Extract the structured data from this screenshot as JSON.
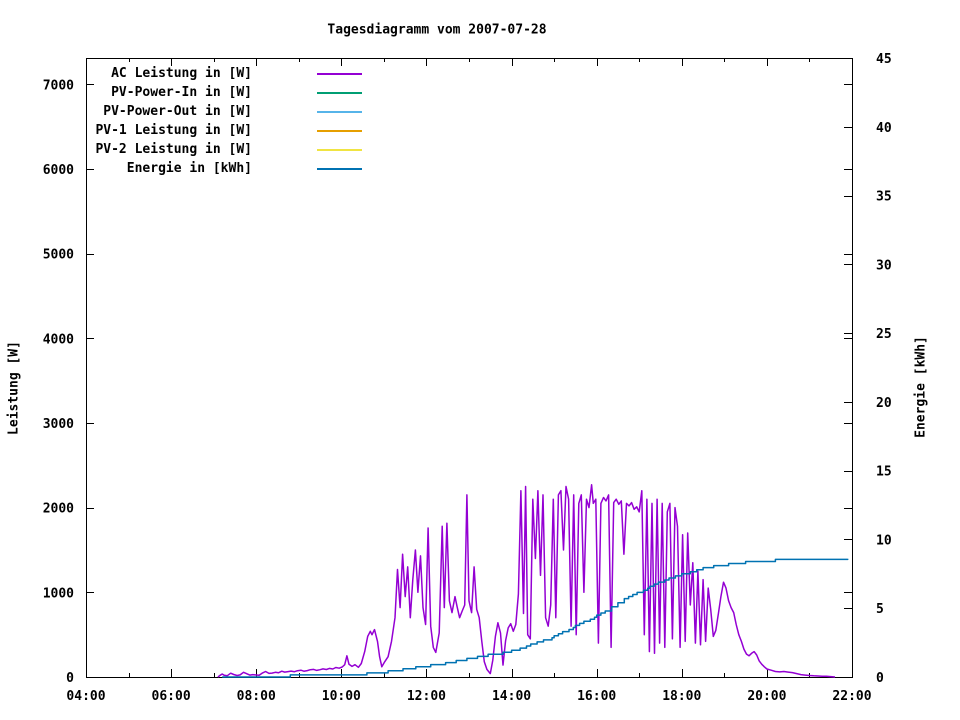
{
  "title": "Tagesdiagramm vom 2007-07-28",
  "axes": {
    "y_label": "Leistung [W]",
    "y2_label": "Energie [kWh]",
    "x_ticks": [
      {
        "h": 4,
        "label": "04:00"
      },
      {
        "h": 6,
        "label": "06:00"
      },
      {
        "h": 8,
        "label": "08:00"
      },
      {
        "h": 10,
        "label": "10:00"
      },
      {
        "h": 12,
        "label": "12:00"
      },
      {
        "h": 14,
        "label": "14:00"
      },
      {
        "h": 16,
        "label": "16:00"
      },
      {
        "h": 18,
        "label": "18:00"
      },
      {
        "h": 20,
        "label": "20:00"
      },
      {
        "h": 22,
        "label": "22:00"
      }
    ],
    "x_minor_hours": [
      5,
      7,
      9,
      11,
      13,
      15,
      17,
      19,
      21
    ],
    "y_ticks": [
      0,
      1000,
      2000,
      3000,
      4000,
      5000,
      6000,
      7000
    ],
    "y2_ticks": [
      0,
      5,
      10,
      15,
      20,
      25,
      30,
      35,
      40,
      45
    ]
  },
  "chart_data": {
    "type": "line",
    "title": "Tagesdiagramm vom 2007-07-28",
    "xlabel": "",
    "ylabel": "Leistung [W]",
    "y2label": "Energie [kWh]",
    "xlim": [
      4,
      22
    ],
    "ylim": [
      0,
      7310
    ],
    "y2lim": [
      0,
      45
    ],
    "grid": false,
    "legend_position": "top-left-inside",
    "series": [
      {
        "name": "AC Leistung in [W]",
        "color": "#9400D3",
        "axis": "y",
        "style": "line",
        "points": [
          [
            7.1,
            0
          ],
          [
            7.15,
            20
          ],
          [
            7.2,
            35
          ],
          [
            7.25,
            20
          ],
          [
            7.32,
            15
          ],
          [
            7.4,
            45
          ],
          [
            7.47,
            30
          ],
          [
            7.55,
            18
          ],
          [
            7.62,
            25
          ],
          [
            7.7,
            55
          ],
          [
            7.77,
            40
          ],
          [
            7.85,
            22
          ],
          [
            7.92,
            28
          ],
          [
            8.0,
            24
          ],
          [
            8.07,
            20
          ],
          [
            8.15,
            48
          ],
          [
            8.22,
            65
          ],
          [
            8.3,
            42
          ],
          [
            8.37,
            46
          ],
          [
            8.45,
            55
          ],
          [
            8.52,
            50
          ],
          [
            8.6,
            68
          ],
          [
            8.67,
            58
          ],
          [
            8.75,
            64
          ],
          [
            8.82,
            70
          ],
          [
            8.9,
            62
          ],
          [
            8.97,
            74
          ],
          [
            9.05,
            80
          ],
          [
            9.12,
            68
          ],
          [
            9.2,
            76
          ],
          [
            9.27,
            86
          ],
          [
            9.35,
            90
          ],
          [
            9.42,
            78
          ],
          [
            9.5,
            86
          ],
          [
            9.57,
            96
          ],
          [
            9.65,
            88
          ],
          [
            9.72,
            102
          ],
          [
            9.8,
            94
          ],
          [
            9.87,
            112
          ],
          [
            9.95,
            104
          ],
          [
            10.02,
            118
          ],
          [
            10.08,
            145
          ],
          [
            10.13,
            250
          ],
          [
            10.18,
            150
          ],
          [
            10.25,
            125
          ],
          [
            10.32,
            145
          ],
          [
            10.4,
            115
          ],
          [
            10.47,
            160
          ],
          [
            10.55,
            300
          ],
          [
            10.62,
            480
          ],
          [
            10.68,
            540
          ],
          [
            10.72,
            500
          ],
          [
            10.78,
            560
          ],
          [
            10.85,
            420
          ],
          [
            10.9,
            240
          ],
          [
            10.95,
            120
          ],
          [
            11.02,
            180
          ],
          [
            11.1,
            240
          ],
          [
            11.18,
            420
          ],
          [
            11.26,
            700
          ],
          [
            11.32,
            1270
          ],
          [
            11.38,
            820
          ],
          [
            11.44,
            1450
          ],
          [
            11.5,
            950
          ],
          [
            11.56,
            1300
          ],
          [
            11.62,
            700
          ],
          [
            11.68,
            1150
          ],
          [
            11.74,
            1500
          ],
          [
            11.8,
            1000
          ],
          [
            11.86,
            1430
          ],
          [
            11.92,
            820
          ],
          [
            11.98,
            620
          ],
          [
            12.04,
            1760
          ],
          [
            12.1,
            600
          ],
          [
            12.16,
            350
          ],
          [
            12.22,
            290
          ],
          [
            12.3,
            520
          ],
          [
            12.37,
            1780
          ],
          [
            12.42,
            820
          ],
          [
            12.48,
            1815
          ],
          [
            12.54,
            900
          ],
          [
            12.6,
            760
          ],
          [
            12.67,
            950
          ],
          [
            12.72,
            830
          ],
          [
            12.78,
            700
          ],
          [
            12.84,
            780
          ],
          [
            12.9,
            850
          ],
          [
            12.95,
            2150
          ],
          [
            13.0,
            900
          ],
          [
            13.06,
            760
          ],
          [
            13.12,
            1300
          ],
          [
            13.18,
            800
          ],
          [
            13.24,
            700
          ],
          [
            13.3,
            420
          ],
          [
            13.36,
            180
          ],
          [
            13.42,
            90
          ],
          [
            13.5,
            40
          ],
          [
            13.56,
            200
          ],
          [
            13.62,
            480
          ],
          [
            13.68,
            640
          ],
          [
            13.74,
            520
          ],
          [
            13.8,
            140
          ],
          [
            13.86,
            430
          ],
          [
            13.92,
            580
          ],
          [
            13.98,
            630
          ],
          [
            14.04,
            540
          ],
          [
            14.1,
            620
          ],
          [
            14.16,
            980
          ],
          [
            14.22,
            2200
          ],
          [
            14.28,
            750
          ],
          [
            14.33,
            2250
          ],
          [
            14.38,
            500
          ],
          [
            14.44,
            450
          ],
          [
            14.5,
            2100
          ],
          [
            14.56,
            1400
          ],
          [
            14.62,
            2200
          ],
          [
            14.68,
            1200
          ],
          [
            14.74,
            2150
          ],
          [
            14.8,
            700
          ],
          [
            14.86,
            600
          ],
          [
            14.92,
            850
          ],
          [
            14.98,
            2100
          ],
          [
            15.04,
            700
          ],
          [
            15.1,
            2150
          ],
          [
            15.16,
            2200
          ],
          [
            15.22,
            1500
          ],
          [
            15.28,
            2250
          ],
          [
            15.34,
            2100
          ],
          [
            15.4,
            600
          ],
          [
            15.46,
            2150
          ],
          [
            15.52,
            500
          ],
          [
            15.58,
            2050
          ],
          [
            15.64,
            2150
          ],
          [
            15.7,
            1000
          ],
          [
            15.76,
            2100
          ],
          [
            15.82,
            2000
          ],
          [
            15.88,
            2270
          ],
          [
            15.92,
            2050
          ],
          [
            15.98,
            2100
          ],
          [
            16.04,
            400
          ],
          [
            16.1,
            2050
          ],
          [
            16.16,
            2120
          ],
          [
            16.22,
            2080
          ],
          [
            16.28,
            2150
          ],
          [
            16.34,
            350
          ],
          [
            16.4,
            2060
          ],
          [
            16.46,
            2100
          ],
          [
            16.52,
            2040
          ],
          [
            16.58,
            2080
          ],
          [
            16.64,
            1450
          ],
          [
            16.7,
            2050
          ],
          [
            16.76,
            2020
          ],
          [
            16.82,
            2060
          ],
          [
            16.88,
            1980
          ],
          [
            16.94,
            2010
          ],
          [
            17.0,
            1950
          ],
          [
            17.06,
            2200
          ],
          [
            17.12,
            500
          ],
          [
            17.18,
            2100
          ],
          [
            17.24,
            300
          ],
          [
            17.3,
            2050
          ],
          [
            17.36,
            280
          ],
          [
            17.42,
            2100
          ],
          [
            17.48,
            400
          ],
          [
            17.54,
            2050
          ],
          [
            17.6,
            350
          ],
          [
            17.66,
            1950
          ],
          [
            17.72,
            2050
          ],
          [
            17.78,
            450
          ],
          [
            17.84,
            2000
          ],
          [
            17.9,
            1780
          ],
          [
            17.96,
            350
          ],
          [
            18.02,
            1680
          ],
          [
            18.08,
            420
          ],
          [
            18.14,
            1700
          ],
          [
            18.2,
            850
          ],
          [
            18.26,
            1350
          ],
          [
            18.32,
            400
          ],
          [
            18.38,
            1250
          ],
          [
            18.44,
            380
          ],
          [
            18.5,
            1150
          ],
          [
            18.56,
            420
          ],
          [
            18.62,
            1050
          ],
          [
            18.68,
            800
          ],
          [
            18.74,
            480
          ],
          [
            18.8,
            550
          ],
          [
            18.86,
            750
          ],
          [
            18.92,
            950
          ],
          [
            18.98,
            1120
          ],
          [
            19.04,
            1050
          ],
          [
            19.1,
            900
          ],
          [
            19.16,
            820
          ],
          [
            19.22,
            760
          ],
          [
            19.28,
            620
          ],
          [
            19.34,
            500
          ],
          [
            19.4,
            420
          ],
          [
            19.46,
            330
          ],
          [
            19.52,
            270
          ],
          [
            19.58,
            250
          ],
          [
            19.64,
            280
          ],
          [
            19.7,
            300
          ],
          [
            19.76,
            260
          ],
          [
            19.82,
            190
          ],
          [
            19.88,
            150
          ],
          [
            19.94,
            120
          ],
          [
            20.0,
            95
          ],
          [
            20.1,
            80
          ],
          [
            20.2,
            65
          ],
          [
            20.3,
            60
          ],
          [
            20.4,
            65
          ],
          [
            20.5,
            58
          ],
          [
            20.6,
            52
          ],
          [
            20.7,
            40
          ],
          [
            20.8,
            28
          ],
          [
            20.9,
            22
          ],
          [
            21.0,
            18
          ],
          [
            21.1,
            14
          ],
          [
            21.2,
            12
          ],
          [
            21.3,
            10
          ],
          [
            21.4,
            8
          ],
          [
            21.5,
            5
          ],
          [
            21.6,
            0
          ]
        ]
      },
      {
        "name": "PV-Power-In in [W]",
        "color": "#009E73",
        "axis": "y",
        "style": "line",
        "points": []
      },
      {
        "name": "PV-Power-Out in [W]",
        "color": "#56B4E9",
        "axis": "y",
        "style": "line",
        "points": []
      },
      {
        "name": "PV-1 Leistung in [W]",
        "color": "#E69F00",
        "axis": "y",
        "style": "line",
        "points": []
      },
      {
        "name": "PV-2 Leistung in [W]",
        "color": "#F0E442",
        "axis": "y",
        "style": "line",
        "points": []
      },
      {
        "name": "Energie in [kWh]",
        "color": "#0072B2",
        "axis": "y2",
        "style": "step",
        "points": [
          [
            7.2,
            0
          ],
          [
            8.0,
            0.03
          ],
          [
            8.5,
            0.06
          ],
          [
            9.0,
            0.09
          ],
          [
            9.5,
            0.12
          ],
          [
            10.0,
            0.16
          ],
          [
            10.5,
            0.2
          ],
          [
            10.8,
            0.28
          ],
          [
            11.0,
            0.35
          ],
          [
            11.25,
            0.45
          ],
          [
            11.5,
            0.55
          ],
          [
            11.75,
            0.68
          ],
          [
            12.0,
            0.8
          ],
          [
            12.25,
            0.92
          ],
          [
            12.5,
            1.05
          ],
          [
            12.75,
            1.2
          ],
          [
            13.0,
            1.35
          ],
          [
            13.25,
            1.5
          ],
          [
            13.5,
            1.6
          ],
          [
            13.7,
            1.7
          ],
          [
            13.85,
            1.8
          ],
          [
            14.0,
            1.9
          ],
          [
            14.25,
            2.15
          ],
          [
            14.5,
            2.4
          ],
          [
            14.75,
            2.65
          ],
          [
            15.0,
            2.95
          ],
          [
            15.25,
            3.3
          ],
          [
            15.5,
            3.7
          ],
          [
            15.75,
            4.1
          ],
          [
            16.0,
            4.5
          ],
          [
            16.25,
            4.85
          ],
          [
            16.4,
            5.15
          ],
          [
            16.55,
            5.45
          ],
          [
            16.75,
            5.8
          ],
          [
            17.0,
            6.15
          ],
          [
            17.25,
            6.55
          ],
          [
            17.5,
            6.9
          ],
          [
            17.75,
            7.2
          ],
          [
            18.0,
            7.45
          ],
          [
            18.25,
            7.65
          ],
          [
            18.5,
            7.9
          ],
          [
            18.75,
            8.05
          ],
          [
            19.0,
            8.15
          ],
          [
            19.25,
            8.28
          ],
          [
            19.5,
            8.33
          ],
          [
            19.75,
            8.4
          ],
          [
            20.0,
            8.44
          ],
          [
            20.25,
            8.5
          ],
          [
            20.5,
            8.55
          ],
          [
            20.7,
            8.6
          ],
          [
            21.9,
            8.6
          ]
        ]
      }
    ]
  }
}
